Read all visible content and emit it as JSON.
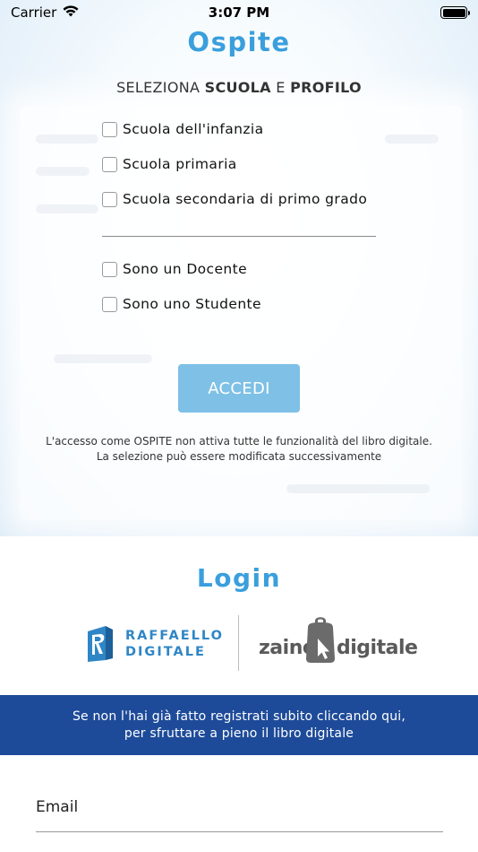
{
  "status_bar": {
    "carrier": "Carrier",
    "time": "3:07 PM"
  },
  "guest": {
    "title": "Ospite",
    "subtitle_prefix": "SELEZIONA ",
    "subtitle_bold_1": "SCUOLA",
    "subtitle_mid": " E ",
    "subtitle_bold_2": "PROFILO",
    "schools": [
      {
        "label": "Scuola dell'infanzia",
        "checked": false
      },
      {
        "label": "Scuola primaria",
        "checked": false
      },
      {
        "label": "Scuola secondaria di primo grado",
        "checked": false
      }
    ],
    "profiles": [
      {
        "label": "Sono un Docente",
        "checked": false
      },
      {
        "label": "Sono uno Studente",
        "checked": false
      }
    ],
    "button_label": "ACCEDI",
    "note_line1": "L'accesso come OSPITE non attiva tutte le funzionalità del libro digitale.",
    "note_line2": "La selezione può essere modificata successivamente"
  },
  "login": {
    "title": "Login",
    "logo_raffaello_line1": "RAFFAELLO",
    "logo_raffaello_line2": "DIGITALE",
    "logo_zaino_word1": "zaino",
    "logo_zaino_word2": "digitale",
    "register_line1": "Se non l'hai già fatto registrati subito cliccando qui,",
    "register_line2": "per sfruttare a pieno il libro digitale",
    "email_label": "Email"
  },
  "colors": {
    "accent": "#3a9fdc",
    "button": "#7ec0e6",
    "banner": "#1e4b99"
  }
}
